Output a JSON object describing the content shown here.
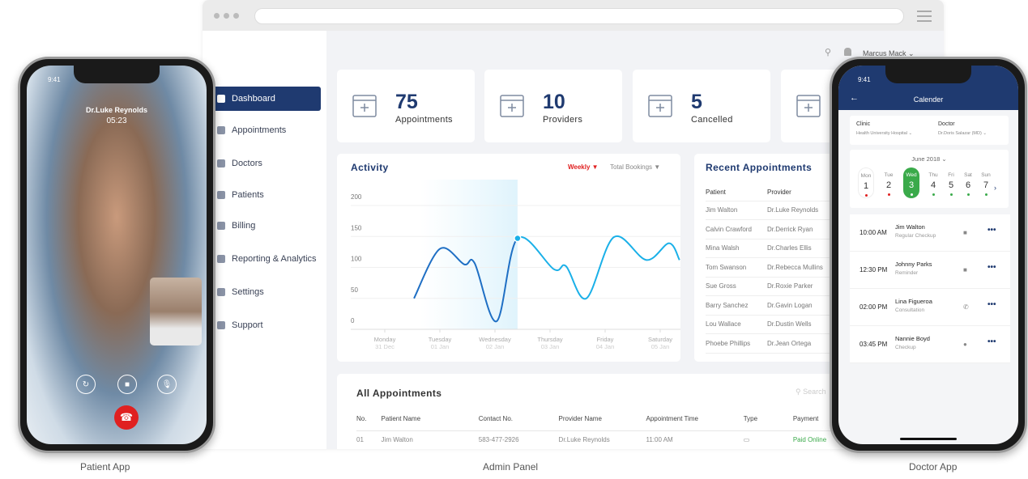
{
  "captions": {
    "patient": "Patient App",
    "admin": "Admin Panel",
    "doctor": "Doctor App"
  },
  "admin": {
    "user": "Marcus Mack",
    "sidebar": [
      "Dashboard",
      "Appointments",
      "Doctors",
      "Patients",
      "Billing",
      "Reporting & Analytics",
      "Settings",
      "Support"
    ],
    "stats": [
      {
        "value": "75",
        "label": "Appointments",
        "icon": "calendar-plus-icon"
      },
      {
        "value": "10",
        "label": "Providers",
        "icon": "doctor-icon"
      },
      {
        "value": "5",
        "label": "Cancelled",
        "icon": "calendar-cancel-icon"
      },
      {
        "value": "",
        "label": "",
        "icon": "money-bag-icon"
      }
    ],
    "activity": {
      "title": "Activity",
      "filter1": "Weekly",
      "filter2": "Total Bookings"
    },
    "recent": {
      "title": "Recent Appointments",
      "headers": [
        "Patient",
        "Provider"
      ],
      "rows": [
        [
          "Jim Walton",
          "Dr.Luke Reynolds"
        ],
        [
          "Calvin Crawford",
          "Dr.Derrick Ryan"
        ],
        [
          "Mina Walsh",
          "Dr.Charles Ellis"
        ],
        [
          "Tom Swanson",
          "Dr.Rebecca Mullins"
        ],
        [
          "Sue Gross",
          "Dr.Roxie Parker"
        ],
        [
          "Barry Sanchez",
          "Dr.Gavin Logan"
        ],
        [
          "Lou Wallace",
          "Dr.Dustin Wells"
        ],
        [
          "Phoebe Phillips",
          "Dr.Jean Ortega"
        ]
      ]
    },
    "all": {
      "title": "All Appointments",
      "search_placeholder": "Search",
      "headers": [
        "No.",
        "Patient Name",
        "Contact No.",
        "Provider Name",
        "Appointment Time",
        "Type",
        "Payment"
      ],
      "rows": [
        [
          "01",
          "Jim Walton",
          "583-477-2926",
          "Dr.Luke Reynolds",
          "11:00 AM",
          "",
          "Paid Online"
        ]
      ]
    },
    "colors": {
      "primary": "#1f3a70",
      "accent": "#1ab0e8",
      "red": "#e02020",
      "green": "#3aaa4a"
    }
  },
  "chart_data": {
    "type": "line",
    "categories": [
      "Monday",
      "Tuesday",
      "Wednesday",
      "Thursday",
      "Friday",
      "Saturday"
    ],
    "category_dates": [
      "31 Dec",
      "01 Jan",
      "02 Jan",
      "03 Jan",
      "04 Jan",
      "05 Jan"
    ],
    "yticks": [
      0,
      50,
      100,
      150,
      200
    ],
    "ylim": [
      0,
      200
    ],
    "grid": true,
    "points": [
      [
        0.53,
        50
      ],
      [
        1.0,
        130
      ],
      [
        1.44,
        105
      ],
      [
        1.63,
        107
      ],
      [
        2.03,
        13
      ],
      [
        2.41,
        147
      ],
      [
        3.07,
        97
      ],
      [
        3.29,
        102
      ],
      [
        3.66,
        50
      ],
      [
        4.16,
        149
      ],
      [
        4.75,
        112
      ],
      [
        5.16,
        139
      ],
      [
        5.35,
        112
      ]
    ],
    "highlight_index": 5
  },
  "patient_app": {
    "time": "9:41",
    "doctor": "Dr.Luke Reynolds",
    "duration": "05:23"
  },
  "doctor_app": {
    "time": "9:41",
    "title": "Calender",
    "clinic_label": "Clinic",
    "clinic": "Health University Hospital",
    "doctor_label": "Doctor",
    "doctor": "Dr.Doris Salazar (MD)",
    "month": "June  2018",
    "days": [
      {
        "n": "Mon",
        "d": "1",
        "dot": "red"
      },
      {
        "n": "Tue",
        "d": "2",
        "dot": "red"
      },
      {
        "n": "Wed",
        "d": "3",
        "dot": "white",
        "selected": true
      },
      {
        "n": "Thu",
        "d": "4",
        "dot": "green"
      },
      {
        "n": "Fri",
        "d": "5",
        "dot": "green"
      },
      {
        "n": "Sat",
        "d": "6",
        "dot": "green"
      },
      {
        "n": "Sun",
        "d": "7",
        "dot": "green"
      }
    ],
    "appointments": [
      {
        "time": "10:00 AM",
        "name": "Jim Walton",
        "type": "Regular Checkup",
        "icon": "video-icon"
      },
      {
        "time": "12:30 PM",
        "name": "Johnny Parks",
        "type": "Reminder",
        "icon": "video-icon"
      },
      {
        "time": "02:00 PM",
        "name": "Lina Figueroa",
        "type": "Consultation",
        "icon": "phone-icon"
      },
      {
        "time": "03:45 PM",
        "name": "Nannie Boyd",
        "type": "Checkup",
        "icon": "chat-icon"
      }
    ]
  }
}
